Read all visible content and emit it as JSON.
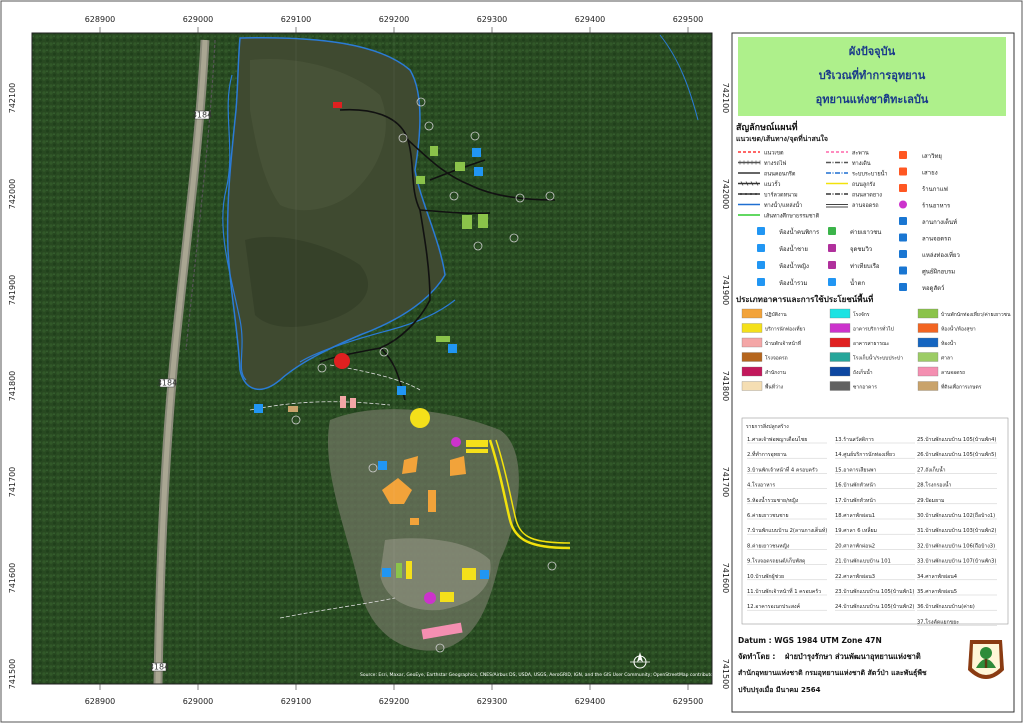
{
  "map": {
    "top_ticks": [
      "628900",
      "629000",
      "629100",
      "629200",
      "629300",
      "629400",
      "629500"
    ],
    "left_ticks": [
      "742100",
      "742000",
      "741900",
      "741800",
      "741700",
      "741600",
      "741500"
    ],
    "road_labels": [
      "3184",
      "3184",
      "3184"
    ]
  },
  "title": {
    "line1": "ผังปัจจุบัน",
    "line2": "บริเวณที่ทำการอุทยาน",
    "line3": "อุทยานแห่งชาติทะเลบัน"
  },
  "legend": {
    "heading": "สัญลักษณ์แผนที่",
    "subheading": "แนวเขต/เส้นทาง/จุดที่น่าสนใจ",
    "line_items": [
      {
        "label": "แนวเขต",
        "color": "#ff3333",
        "style": "dash"
      },
      {
        "label": "สะพาน",
        "color": "#ff66aa",
        "style": "dash"
      },
      {
        "label": "ทางรถไฟ",
        "color": "#555555",
        "style": "rail"
      },
      {
        "label": "ทางเดิน",
        "color": "#555555",
        "style": "dashdot"
      },
      {
        "label": "ถนนคอนกรีต",
        "color": "#333333",
        "style": "solid"
      },
      {
        "label": "ระบบระบายน้ำ",
        "color": "#1f6fd1",
        "style": "dashdot"
      },
      {
        "label": "แนวรั้ว",
        "color": "#333333",
        "style": "fence"
      },
      {
        "label": "ถนนลูกรัง",
        "color": "#f2e20c",
        "style": "solid"
      },
      {
        "label": "บาร์ลวดหนาม",
        "color": "#333333",
        "style": "wire"
      },
      {
        "label": "ถนนลาดยาง",
        "color": "#333333",
        "style": "dashdot"
      },
      {
        "label": "ทางน้ำ/แหล่งน้ำ",
        "color": "#1f6fd1",
        "style": "solid"
      },
      {
        "label": "ลานจอดรถ",
        "color": "#444444",
        "style": "double"
      },
      {
        "label": "เส้นทางศึกษาธรรมชาติ",
        "color": "#2fcc2f",
        "style": "solid"
      }
    ],
    "point_right": [
      {
        "label": "เสาวิทยุ",
        "icon": "antenna-icon"
      },
      {
        "label": "เสาธง",
        "icon": "flag-icon"
      },
      {
        "label": "ร้านกาแฟ",
        "icon": "coffee-icon"
      },
      {
        "label": "ร้านอาหาร",
        "icon": "restaurant-icon"
      },
      {
        "label": "ลานกางเต็นท์",
        "icon": "tent-icon"
      },
      {
        "label": "ลานจอดรถ",
        "icon": "parking-icon"
      },
      {
        "label": "แหล่งท่องเที่ยว",
        "icon": "attraction-icon"
      },
      {
        "label": "ศูนย์ฝึกอบรม",
        "icon": "training-icon"
      },
      {
        "label": "หอดูสัตว์",
        "icon": "tower-icon"
      }
    ],
    "point_grid": [
      {
        "label": "ห้องน้ำคนพิการ",
        "icon": "accessible-toilet-icon",
        "color": "#2196f3"
      },
      {
        "label": "ค่ายเยาวชน",
        "icon": "youth-camp-icon",
        "color": "#3bb44a"
      },
      {
        "label": "ห้องน้ำชาย",
        "icon": "male-toilet-icon",
        "color": "#2196f3"
      },
      {
        "label": "จุดชมวิว",
        "icon": "viewpoint-icon",
        "color": "#b0309c"
      },
      {
        "label": "ห้องน้ำหญิง",
        "icon": "female-toilet-icon",
        "color": "#2196f3"
      },
      {
        "label": "ท่าเทียบเรือ",
        "icon": "pier-icon",
        "color": "#b0309c"
      },
      {
        "label": "ห้องน้ำรวม",
        "icon": "shared-toilet-icon",
        "color": "#2196f3"
      },
      {
        "label": "น้ำตก",
        "icon": "waterfall-icon",
        "color": "#2196f3"
      }
    ],
    "building_heading": "ประเภทอาคารและการใช้ประโยชน์พื้นที่",
    "building_items": [
      {
        "label": "ปฏิบัติงาน",
        "color": "#f2a33a"
      },
      {
        "label": "โรงจักร",
        "color": "#1de3e3"
      },
      {
        "label": "บ้านพักนักท่องเที่ยว/ค่ายเยาวชน",
        "color": "#8bc34a"
      },
      {
        "label": "บริการนักท่องเที่ยว",
        "color": "#f4e01a"
      },
      {
        "label": "อาคารบริการทั่วไป",
        "color": "#cc33cc"
      },
      {
        "label": "ห้องน้ำ/ห้องสุขา",
        "color": "#f26522"
      },
      {
        "label": "บ้านพักเจ้าหน้าที่",
        "color": "#f4a6a6"
      },
      {
        "label": "อาคารสาธารณะ",
        "color": "#e02020"
      },
      {
        "label": "ห้องน้ำ",
        "color": "#1565c0"
      },
      {
        "label": "โรงจอดรถ",
        "color": "#b5651d"
      },
      {
        "label": "โรงเก็บน้ำ/ระบบประปา",
        "color": "#26a69a"
      },
      {
        "label": "ศาลา",
        "color": "#9ccc65"
      },
      {
        "label": "สำนักงาน",
        "color": "#c2185b"
      },
      {
        "label": "ถังเก็บน้ำ",
        "color": "#0d47a1"
      },
      {
        "label": "ลานจอดรถ",
        "color": "#f48fb1"
      },
      {
        "label": "พื้นที่ว่าง",
        "color": "#f5deb3"
      },
      {
        "label": "ซากอาคาร",
        "color": "#616161"
      },
      {
        "label": "ที่ดินเพื่อการเกษตร",
        "color": "#c9a36b"
      }
    ],
    "list_heading": "รายการสิ่งปลูกสร้าง",
    "list_col1": [
      "1.ศาลเจ้าพ่อพญาเดือนไชย",
      "2.ที่ทำการอุทยาน",
      "3.บ้านพักเจ้าหน้าที่ 4 ครอบครัว",
      "4.โรงอาหาร",
      "5.ห้องน้ำรวมชาย/หญิง",
      "6.ค่ายเยาวชนชาย",
      "7.บ้านพักแบบบ้าน 2(ลานกางเต็นท์)",
      "8.ค่ายเยาวชนหญิง",
      "9.โรงจอดรถยนต์/เก็บพัสดุ",
      "10.บ้านพักผู้ช่วย",
      "11.บ้านพักเจ้าหน้าที่ 1 ครอบครัว",
      "12.อาคารอเนกประสงค์"
    ],
    "list_col2": [
      "13.ร้านสวัสดิการ",
      "14.ศูนย์บริการนักท่องเที่ยว",
      "15.อาคารเสียนพา",
      "16.บ้านพักหัวหน้า",
      "17.บ้านพักหัวหน้า",
      "18.ศาลาพักผ่อน1",
      "19.ศาลา 6 เหลี่ยม",
      "20.ศาลาพักผ่อน2",
      "21.บ้านพักแบบบ้าน 101",
      "22.ศาลาพักผ่อน3",
      "23.บ้านพักแบบบ้าน 105(บ้านพัก1)",
      "24.บ้านพักแบบบ้าน 105(บ้านพัก2)"
    ],
    "list_col3": [
      "25.บ้านพักแบบบ้าน 105(บ้านพัก4)",
      "26.บ้านพักแบบบ้าน 105(บ้านพัก5)",
      "27.ถังเก็บน้ำ",
      "28.โรงกรองน้ำ",
      "29.ป้อมยาม",
      "30.บ้านพักแบบบ้าน 102(ถือบ้าง1)",
      "31.บ้านพักแบบบ้าน 103(บ้านพัก2)",
      "32.บ้านพักแบบบ้าน 106(ถือบ้าง3)",
      "33.บ้านพักแบบบ้าน 107(บ้านพัก3)",
      "34.ศาลาพักผ่อน4",
      "35.ศาลาพักผ่อน5",
      "36.บ้านพักแบบบ้าน(ค่าย)",
      "37.โรงคัดแยกขยะ"
    ],
    "datum": "Datum  : WGS 1984 UTM Zone 47N",
    "prepared_label": "จัดทำโดย  :",
    "prepared_by": "ฝ่ายบำรุงรักษา ส่วนพัฒนาอุทยานแห่งชาติ",
    "office": "สำนักอุทยานแห่งชาติ  กรมอุทยานแห่งชาติ สัตว์ป่า และพันธุ์พืช",
    "updated": "ปรับปรุงเมื่อ มีนาคม 2564"
  },
  "attribution": "Source: Esri, Maxar, GeoEye, Earthstar Geographics, CNES/Airbus DS, USDA, USGS, AeroGRID, IGN, and the GIS User Community; OpenStreetMap contributors, Esri, HERE, Garmin, (c) OpenStreetMap contributors, and the GIS user community"
}
